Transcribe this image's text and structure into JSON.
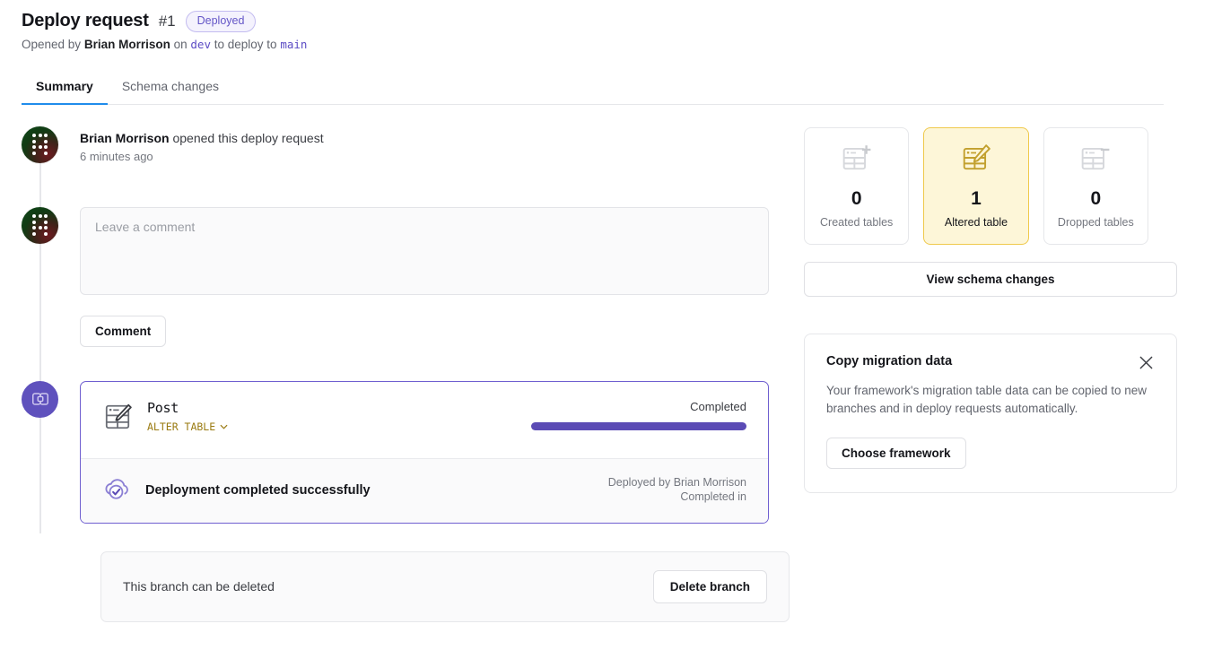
{
  "header": {
    "title": "Deploy request",
    "number": "#1",
    "status_badge": "Deployed",
    "opened_by_prefix": "Opened by",
    "author": "Brian Morrison",
    "on_word": "on",
    "source_branch": "dev",
    "deploy_to_word": "to deploy to",
    "target_branch": "main",
    "badge_color": "#6355c7"
  },
  "tabs": [
    {
      "label": "Summary",
      "active": true
    },
    {
      "label": "Schema changes",
      "active": false
    }
  ],
  "timeline": {
    "event": {
      "author": "Brian Morrison",
      "action": " opened this deploy request",
      "time": "6 minutes ago"
    },
    "comment": {
      "placeholder": "Leave a comment",
      "value": "",
      "submit_label": "Comment"
    },
    "deployment": {
      "table_name": "Post",
      "operation": "ALTER TABLE",
      "status": "Completed",
      "progress_percent": 100,
      "progress_color": "#5b4bb5",
      "result_message": "Deployment completed successfully",
      "deployed_by": "Deployed by Brian Morrison",
      "completed_in": "Completed in"
    }
  },
  "delete_branch": {
    "message": "This branch can be deleted",
    "button_label": "Delete branch"
  },
  "sidebar": {
    "stats": [
      {
        "value": "0",
        "label": "Created tables",
        "icon": "table-add-icon",
        "highlight": false
      },
      {
        "value": "1",
        "label": "Altered table",
        "icon": "table-edit-icon",
        "highlight": true
      },
      {
        "value": "0",
        "label": "Dropped tables",
        "icon": "table-remove-icon",
        "highlight": false
      }
    ],
    "view_schema_label": "View schema changes",
    "migration": {
      "title": "Copy migration data",
      "description": "Your framework's migration table data can be copied to new branches and in deploy requests automatically.",
      "button_label": "Choose framework"
    },
    "highlight_color": "#efc94c"
  }
}
